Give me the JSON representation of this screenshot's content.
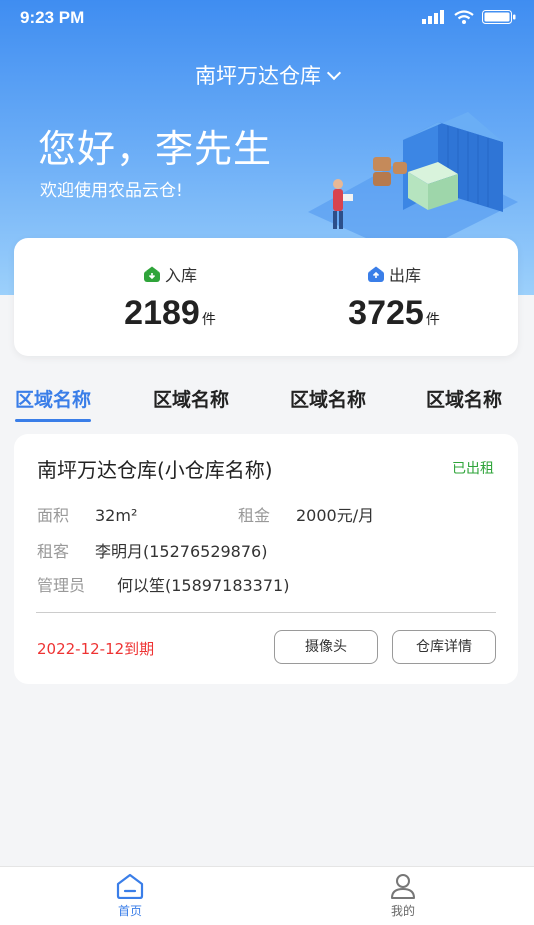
{
  "status_bar": {
    "time": "9:23 PM"
  },
  "header": {
    "warehouse_title": "南坪万达仓库",
    "greeting": "您好，李先生",
    "welcome": "欢迎使用农品云仓!"
  },
  "stats": {
    "inbound": {
      "label": "入库",
      "value": "2189",
      "unit": "件"
    },
    "outbound": {
      "label": "出库",
      "value": "3725",
      "unit": "件"
    }
  },
  "tabs": [
    {
      "label": "区域名称",
      "active": true
    },
    {
      "label": "区域名称",
      "active": false
    },
    {
      "label": "区域名称",
      "active": false
    },
    {
      "label": "区域名称",
      "active": false
    }
  ],
  "warehouse_card": {
    "name": "南坪万达仓库(小仓库名称)",
    "status": "已出租",
    "area_label": "面积",
    "area_value": "32m²",
    "rent_label": "租金",
    "rent_value": "2000元/月",
    "tenant_label": "租客",
    "tenant_value": "李明月(15276529876)",
    "manager_label": "管理员",
    "manager_value": "何以笙(15897183371)",
    "expire": "2022-12-12到期",
    "camera_button": "摄像头",
    "detail_button": "仓库详情"
  },
  "bottom_nav": [
    {
      "label": "首页",
      "icon": "home-icon",
      "active": true
    },
    {
      "label": "我的",
      "icon": "user-icon",
      "active": false
    }
  ],
  "colors": {
    "primary": "#3a7ee8",
    "status_green": "#2fa43a",
    "expire_red": "#e33333"
  }
}
